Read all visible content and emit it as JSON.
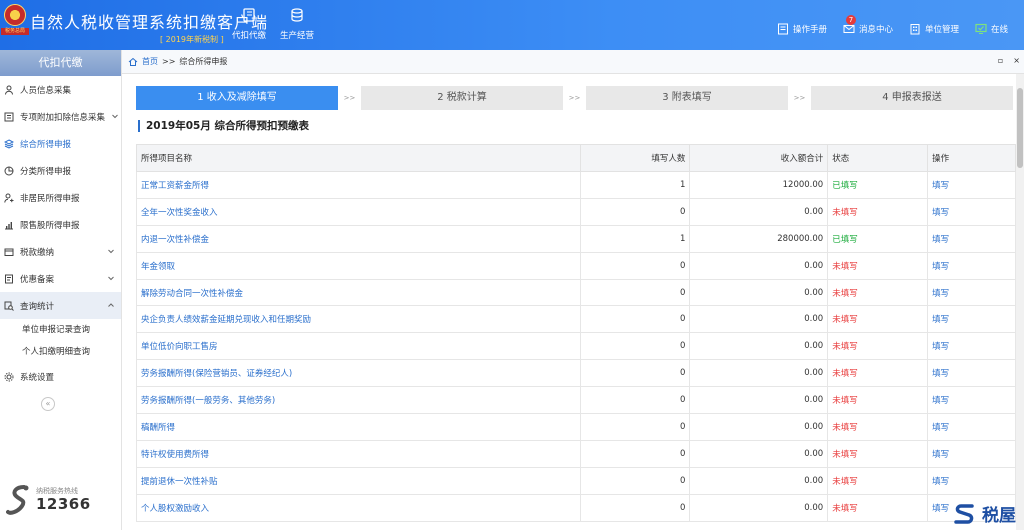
{
  "header": {
    "app_title": "自然人税收管理系统扣缴客户端",
    "version": "[ 2019年新税制 ]",
    "logo_text": "税务总局",
    "nav": [
      {
        "label": "代扣代缴",
        "icon": "book-icon"
      },
      {
        "label": "生产经营",
        "icon": "coins-icon"
      }
    ],
    "tools": [
      {
        "label": "操作手册",
        "icon": "manual-icon"
      },
      {
        "label": "消息中心",
        "icon": "mail-icon",
        "badge": "7"
      },
      {
        "label": "单位管理",
        "icon": "building-icon"
      },
      {
        "label": "在线",
        "icon": "online-icon"
      }
    ]
  },
  "sidebar": {
    "title": "代扣代缴",
    "items": [
      {
        "label": "人员信息采集",
        "icon": "person-icon"
      },
      {
        "label": "专项附加扣除信息采集",
        "icon": "list-icon",
        "expandable": true
      },
      {
        "label": "综合所得申报",
        "icon": "stack-icon",
        "active": true
      },
      {
        "label": "分类所得申报",
        "icon": "pie-icon"
      },
      {
        "label": "非居民所得申报",
        "icon": "user-plus-icon"
      },
      {
        "label": "限售股所得申报",
        "icon": "bar-chart-icon"
      },
      {
        "label": "税款缴纳",
        "icon": "wallet-icon",
        "expandable": true
      },
      {
        "label": "优惠备案",
        "icon": "note-icon",
        "expandable": true
      },
      {
        "label": "查询统计",
        "icon": "query-icon",
        "expandable": true,
        "open": true
      }
    ],
    "sub_items": [
      "单位申报记录查询",
      "个人扣缴明细查询"
    ],
    "settings": "系统设置",
    "hotline_label": "纳税服务热线",
    "hotline_number": "12366"
  },
  "breadcrumb": {
    "home": "首页",
    "sep": ">>",
    "current": "综合所得申报"
  },
  "steps": [
    {
      "label": "1 收入及减除填写",
      "active": true
    },
    {
      "label": "2 税款计算"
    },
    {
      "label": "3 附表填写"
    },
    {
      "label": "4 申报表报送"
    }
  ],
  "step_sep": ">>",
  "form_title": "2019年05月  综合所得预扣预缴表",
  "table": {
    "headers": [
      "所得项目名称",
      "填写人数",
      "收入额合计",
      "状态",
      "操作"
    ],
    "rows": [
      {
        "name": "正常工资薪金所得",
        "count": "1",
        "amount": "12000.00",
        "status": "已填写",
        "done": true,
        "op": "填写"
      },
      {
        "name": "全年一次性奖金收入",
        "count": "0",
        "amount": "0.00",
        "status": "未填写",
        "done": false,
        "op": "填写"
      },
      {
        "name": "内退一次性补偿金",
        "count": "1",
        "amount": "280000.00",
        "status": "已填写",
        "done": true,
        "op": "填写"
      },
      {
        "name": "年金领取",
        "count": "0",
        "amount": "0.00",
        "status": "未填写",
        "done": false,
        "op": "填写"
      },
      {
        "name": "解除劳动合同一次性补偿金",
        "count": "0",
        "amount": "0.00",
        "status": "未填写",
        "done": false,
        "op": "填写"
      },
      {
        "name": "央企负责人绩效薪金延期兑现收入和任期奖励",
        "count": "0",
        "amount": "0.00",
        "status": "未填写",
        "done": false,
        "op": "填写"
      },
      {
        "name": "单位低价向职工售房",
        "count": "0",
        "amount": "0.00",
        "status": "未填写",
        "done": false,
        "op": "填写"
      },
      {
        "name": "劳务报酬所得(保险营销员、证券经纪人)",
        "count": "0",
        "amount": "0.00",
        "status": "未填写",
        "done": false,
        "op": "填写"
      },
      {
        "name": "劳务报酬所得(一般劳务、其他劳务)",
        "count": "0",
        "amount": "0.00",
        "status": "未填写",
        "done": false,
        "op": "填写"
      },
      {
        "name": "稿酬所得",
        "count": "0",
        "amount": "0.00",
        "status": "未填写",
        "done": false,
        "op": "填写"
      },
      {
        "name": "特许权使用费所得",
        "count": "0",
        "amount": "0.00",
        "status": "未填写",
        "done": false,
        "op": "填写"
      },
      {
        "name": "提前退休一次性补贴",
        "count": "0",
        "amount": "0.00",
        "status": "未填写",
        "done": false,
        "op": "填写"
      },
      {
        "name": "个人股权激励收入",
        "count": "0",
        "amount": "0.00",
        "status": "未填写",
        "done": false,
        "op": "填写"
      }
    ]
  },
  "watermark": "税屋",
  "colors": {
    "header": "#2f7eea",
    "accent": "#2a6fcc",
    "done": "#1bab3b",
    "pending": "#e83a3a",
    "step_active": "#3a8ef0"
  }
}
